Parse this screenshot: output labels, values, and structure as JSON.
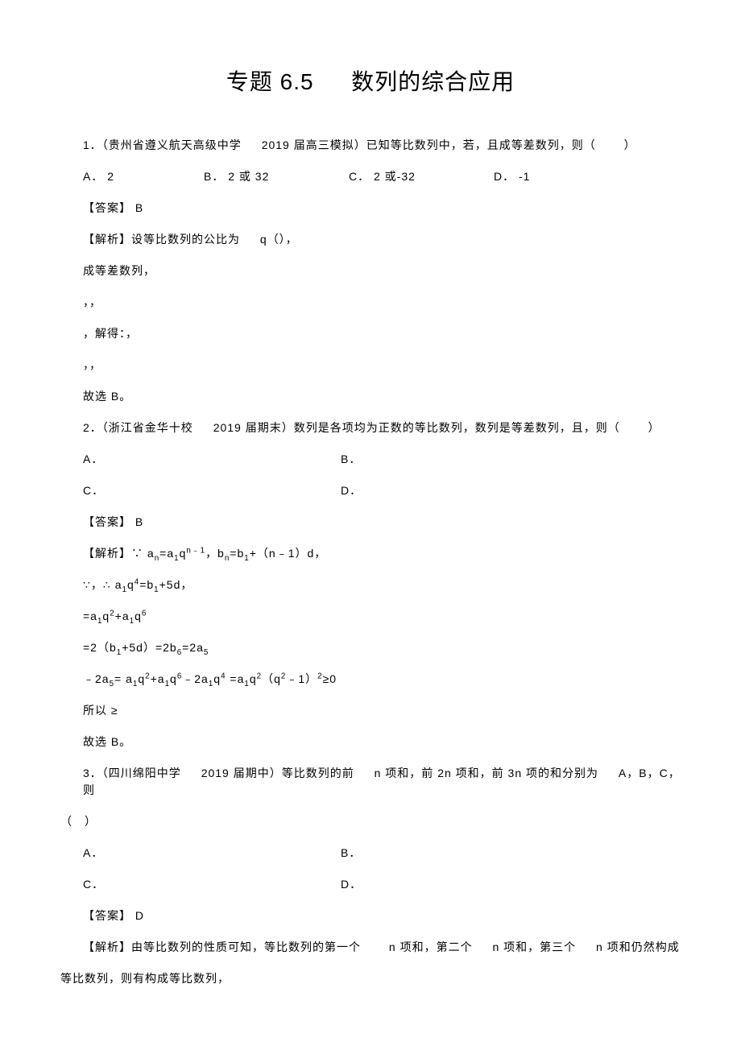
{
  "title": "专题 6.5   数列的综合应用",
  "q1": {
    "prompt_a": "1．（贵州省遵义航天高级中学",
    "prompt_b": "2019 届高三模拟）已知等比数列中，若，且成等差数列，则（",
    "prompt_c": "）",
    "choices": {
      "a": "A． 2",
      "b": "B． 2 或 32",
      "c": "C． 2 或-32",
      "d": "D． -1"
    },
    "ans_label": "【答案】 B",
    "sol_label": "【解析】设等比数列的公比为",
    "sol_label2": "q（），",
    "l1": "成等差数列，",
    "l2": "，，",
    "l3": "，解得：，",
    "l4": "，，",
    "l5": "故选 B。"
  },
  "q2": {
    "prompt_a": "2．（浙江省金华十校",
    "prompt_b": "2019 届期末）数列是各项均为正数的等比数列，数列是等差数列，且，则（",
    "prompt_c": "）",
    "row1": {
      "a": "A．",
      "b": "B．"
    },
    "row2": {
      "c": "C．",
      "d": "D．"
    },
    "ans_label": "【答案】 B",
    "sol1": "【解析】∵ aₙ=a₁qⁿ⁻¹，bₙ=b₁+（n﹣1）d，",
    "sol2": "∵，∴ a₁q⁴=b₁+5d，",
    "sol3": "=a₁q²+a₁q⁶",
    "sol4": "=2（b₁+5d）=2b₆=2a₅",
    "sol5": "﹣2a₅= a₁q²+a₁q⁶﹣2a₁q⁴ =a₁q²（q²﹣1）²≥0",
    "sol6": "所以 ≥",
    "sol7": "故选 B。"
  },
  "q3": {
    "prompt_a": "3．（四川绵阳中学",
    "prompt_b": "2019 届期中）等比数列的前",
    "prompt_c": "n 项和，前 2n 项和，前 3n 项的和分别为",
    "prompt_d": "A，B，C，则",
    "paren": "（ ）",
    "row1": {
      "a": "A．",
      "b": "B．"
    },
    "row2": {
      "c": "C．",
      "d": "D．"
    },
    "ans_label": "【答案】 D",
    "sol_a": "【解析】由等比数列的性质可知，等比数列的第一个",
    "sol_b": "n 项和，第二个",
    "sol_c": "n 项和，第三个",
    "sol_d": "n 项和仍然构成",
    "sol2": "等比数列，则有构成等比数列，"
  }
}
